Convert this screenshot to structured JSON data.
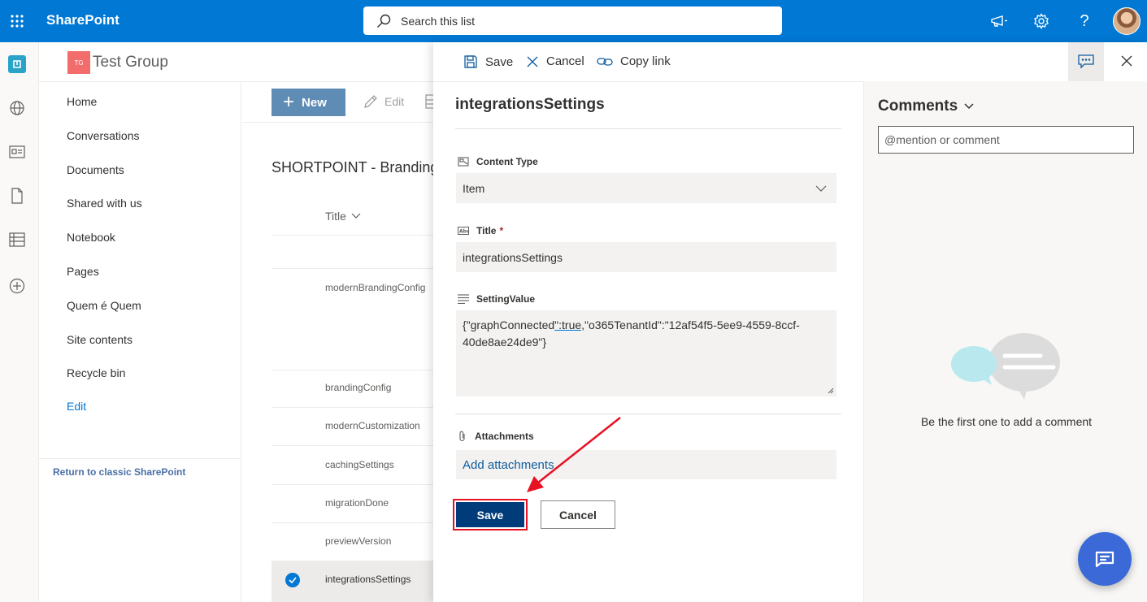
{
  "suitebar": {
    "app_name": "SharePoint",
    "search_placeholder": "Search this list"
  },
  "site": {
    "logo_initials": "TG",
    "title": "Test Group"
  },
  "leftnav": {
    "items": [
      {
        "label": "Home"
      },
      {
        "label": "Conversations"
      },
      {
        "label": "Documents"
      },
      {
        "label": "Shared with us"
      },
      {
        "label": "Notebook"
      },
      {
        "label": "Pages"
      },
      {
        "label": "Quem é Quem"
      },
      {
        "label": "Site contents"
      },
      {
        "label": "Recycle bin"
      },
      {
        "label": "Edit"
      }
    ],
    "classic_link": "Return to classic SharePoint"
  },
  "commandbar": {
    "new_label": "New",
    "edit_label": "Edit"
  },
  "list": {
    "title": "SHORTPOINT - Branding",
    "column_title": "Title",
    "rows": [
      {
        "title": "modernBrandingConfig"
      },
      {
        "title": "brandingConfig"
      },
      {
        "title": "modernCustomization"
      },
      {
        "title": "cachingSettings"
      },
      {
        "title": "migrationDone"
      },
      {
        "title": "previewVersion"
      },
      {
        "title": "integrationsSettings"
      }
    ]
  },
  "panel": {
    "save_label": "Save",
    "cancel_label": "Cancel",
    "copy_link_label": "Copy link",
    "form_title": "integrationsSettings",
    "content_type": {
      "label": "Content Type",
      "value": "Item"
    },
    "title_field": {
      "label": "Title",
      "required_mark": "*",
      "value": "integrationsSettings"
    },
    "setting_value": {
      "label": "SettingValue",
      "part1": "{\"graphConnected",
      "part2": "\":true,",
      "part3": "\"o365TenantId\":\"12af54f5-5ee9-4559-8ccf-40de8ae24de9\"}"
    },
    "attachments": {
      "label": "Attachments",
      "add_label": "Add attachments"
    },
    "footer_save": "Save",
    "footer_cancel": "Cancel"
  },
  "comments": {
    "title": "Comments",
    "input_placeholder": "@mention or comment",
    "empty_text": "Be the first one to add a comment"
  },
  "colors": {
    "suitebar": "#0078d4",
    "primary_button": "#003c7a",
    "highlight_box": "#e81123",
    "chat_bubble": "#3b6ad8"
  }
}
